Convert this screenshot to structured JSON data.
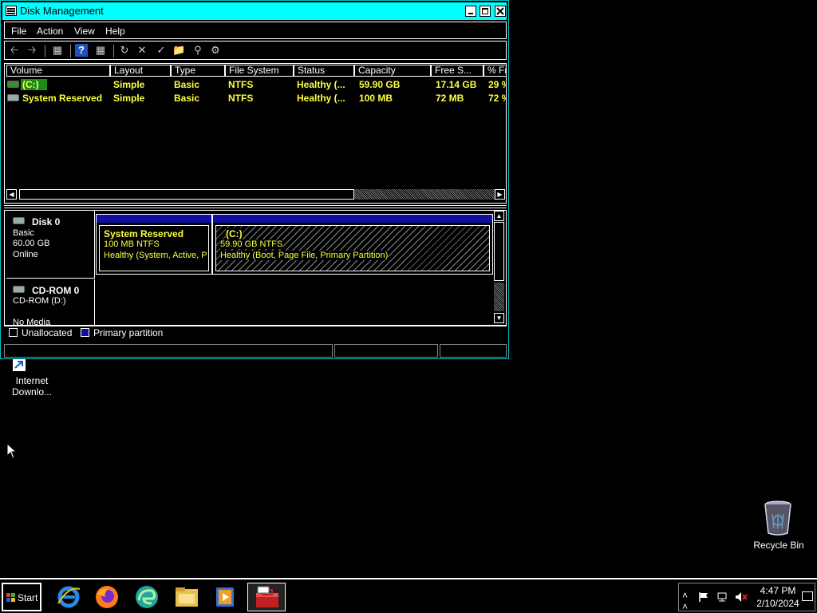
{
  "window": {
    "title": "Disk Management",
    "menu": [
      "File",
      "Action",
      "View",
      "Help"
    ]
  },
  "volumes": {
    "columns": [
      "Volume",
      "Layout",
      "Type",
      "File System",
      "Status",
      "Capacity",
      "Free S...",
      "% Fr"
    ],
    "rows": [
      [
        "(C:)",
        "Simple",
        "Basic",
        "NTFS",
        "Healthy (...",
        "59.90 GB",
        "17.14 GB",
        "29 %"
      ],
      [
        "System Reserved",
        "Simple",
        "Basic",
        "NTFS",
        "Healthy (...",
        "100 MB",
        "72 MB",
        "72 %"
      ]
    ]
  },
  "disk0": {
    "name": "Disk 0",
    "type": "Basic",
    "size": "60.00 GB",
    "state": "Online",
    "partitions": [
      {
        "title": "System Reserved",
        "size": "100 MB NTFS",
        "status": "Healthy (System, Active, Pri"
      },
      {
        "title": "(C:)",
        "size": "59.90 GB NTFS",
        "status": "Healthy (Boot, Page File, Primary Partition)"
      }
    ]
  },
  "cdrom0": {
    "name": "CD-ROM 0",
    "drive": "CD-ROM (D:)",
    "media": "No Media"
  },
  "legend": {
    "unallocated": "Unallocated",
    "primary": "Primary partition",
    "unallocated_color": "#000000",
    "primary_color": "#1010a0"
  },
  "desktop": {
    "icon1_label_line1": "Internet",
    "icon1_label_line2": "Downlo...",
    "recycle_bin": "Recycle Bin"
  },
  "taskbar": {
    "start": "Start",
    "apps": [
      "internet-explorer-icon",
      "firefox-icon",
      "edge-icon",
      "file-explorer-icon",
      "media-player-icon",
      "disk-management-icon"
    ],
    "time": "4:47 PM",
    "date": "2/10/2024"
  }
}
